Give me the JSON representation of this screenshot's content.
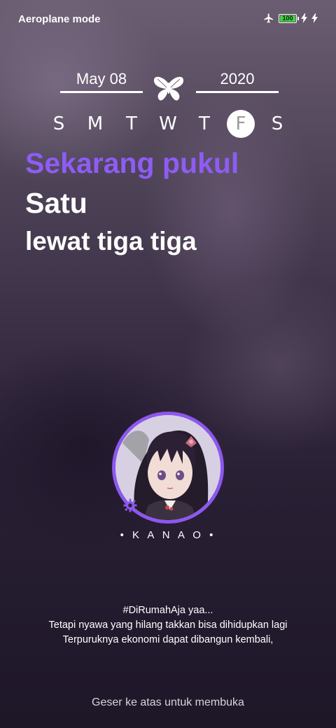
{
  "status_bar": {
    "mode_label": "Aeroplane mode",
    "battery_level": "100",
    "battery_percent": 100,
    "battery_color": "#3ed23e",
    "icons": [
      "airplane-icon",
      "battery-icon",
      "bolt-icon",
      "bolt-icon"
    ]
  },
  "date": {
    "day_month": "May 08",
    "year": "2020",
    "ornament_icon": "butterfly-icon"
  },
  "week": {
    "days": [
      "S",
      "M",
      "T",
      "W",
      "T",
      "F",
      "S"
    ],
    "active_index": 5
  },
  "time_text": {
    "line1": "Sekarang pukul",
    "line2": "Satu",
    "line3": "lewat tiga tiga",
    "accent_color": "#8e5cf5"
  },
  "profile": {
    "name": "• K A N A O •",
    "ring_color": "#8c58ee",
    "badge_icon": "gear-icon"
  },
  "quote": {
    "line1": "#DiRumahAja yaa...",
    "line2": "Tetapi nyawa yang hilang takkan bisa dihidupkan lagi",
    "line3": "Terpuruknya ekonomi dapat dibangun kembali,"
  },
  "unlock_hint": "Geser ke atas untuk membuka"
}
